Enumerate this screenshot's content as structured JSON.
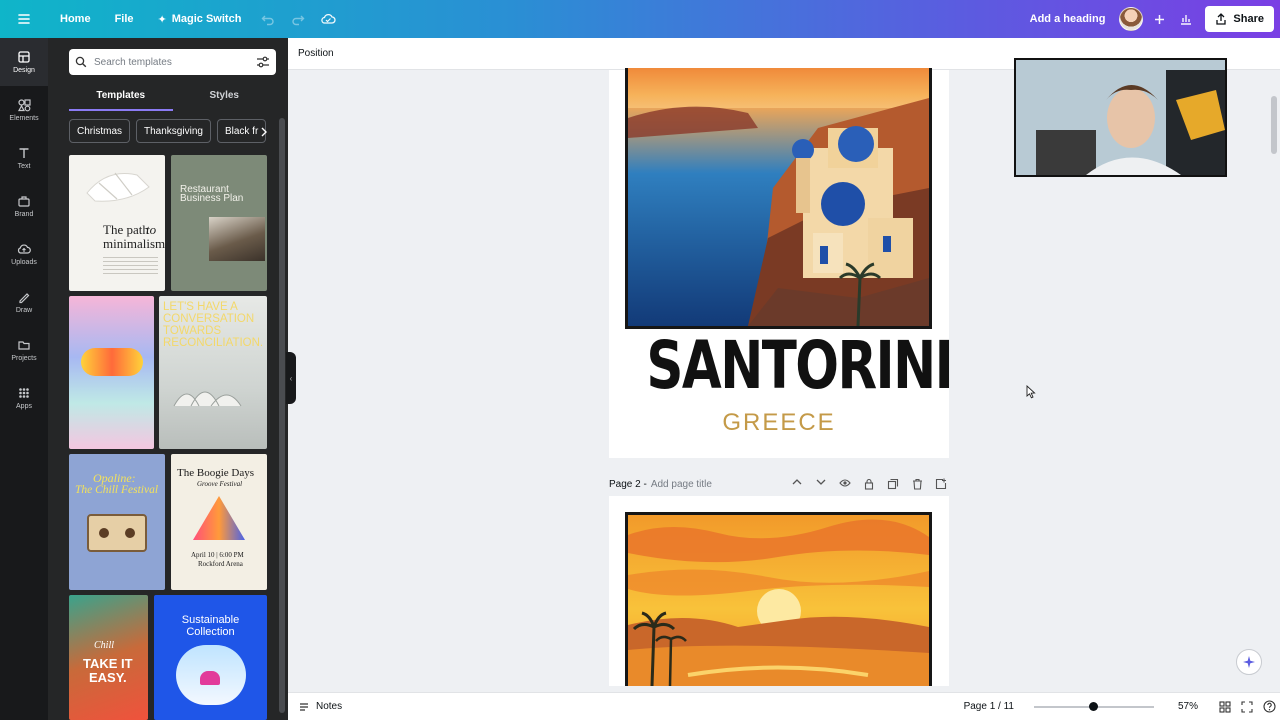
{
  "topbar": {
    "home": "Home",
    "file": "File",
    "magic_switch": "Magic Switch",
    "add_heading": "Add a heading",
    "share": "Share"
  },
  "rail": {
    "items": [
      {
        "label": "Design",
        "icon": "design-icon"
      },
      {
        "label": "Elements",
        "icon": "elements-icon"
      },
      {
        "label": "Text",
        "icon": "text-icon"
      },
      {
        "label": "Brand",
        "icon": "brand-icon"
      },
      {
        "label": "Uploads",
        "icon": "uploads-icon"
      },
      {
        "label": "Draw",
        "icon": "draw-icon"
      },
      {
        "label": "Projects",
        "icon": "projects-icon"
      },
      {
        "label": "Apps",
        "icon": "apps-icon"
      }
    ]
  },
  "panel": {
    "search_placeholder": "Search templates",
    "tabs": [
      "Templates",
      "Styles"
    ],
    "chips": [
      "Christmas",
      "Thanksgiving",
      "Black fr"
    ],
    "templates": {
      "t1": {
        "line1": "The path",
        "line2": "to",
        "line3": "minimalism"
      },
      "t2": {
        "line1": "Restaurant",
        "line2": "Business Plan"
      },
      "t4": {
        "text": "LET'S HAVE A CONVERSATION TOWARDS RECONCILIATION."
      },
      "t5": {
        "line1": "Opaline:",
        "line2": "The Chill Festival"
      },
      "t6": {
        "line1": "The Boogie Days",
        "line2": "Groove Festival",
        "line3": "April 10 | 6:00 PM",
        "line4": "Rockford Arena"
      },
      "t7": {
        "line1": "Chill",
        "line2": "TAKE IT",
        "line3": "EASY."
      },
      "t8": {
        "line1": "Sustainable",
        "line2": "Collection"
      }
    }
  },
  "canvas": {
    "position_label": "Position",
    "page1_title": "SANTORINI",
    "page1_subtitle": "GREECE",
    "page2_label": "Page 2 -",
    "page2_placeholder": "Add page title"
  },
  "bottombar": {
    "notes": "Notes",
    "page_info": "Page 1 / 11",
    "zoom": "57%"
  },
  "colors": {
    "accent": "#8b7bf4",
    "subtitle_gold": "#c49a48"
  }
}
